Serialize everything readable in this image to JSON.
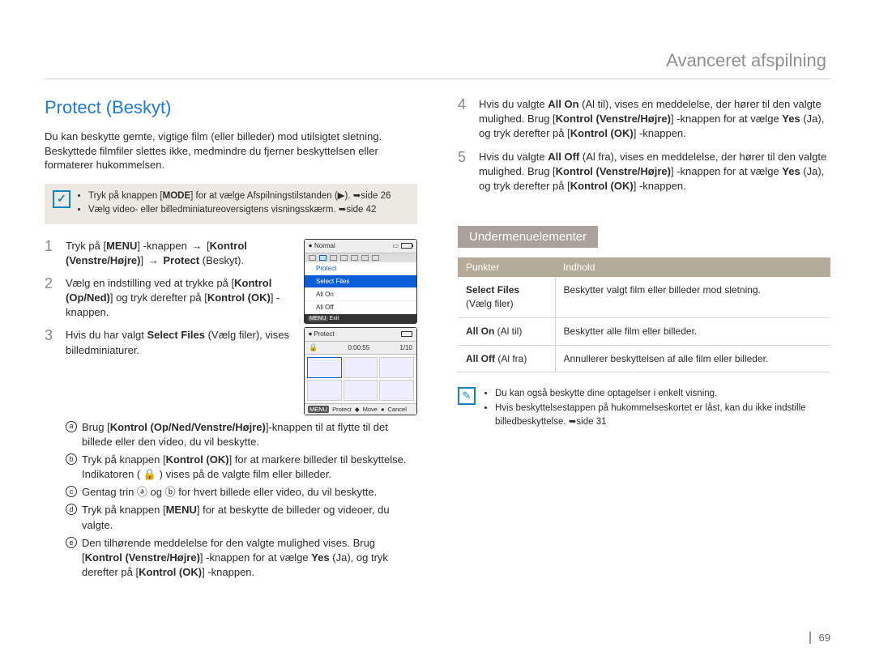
{
  "chapter": "Avanceret afspilning",
  "section_title": "Protect (Beskyt)",
  "intro": "Du kan beskytte gemte, vigtige film (eller billeder) mod utilsigtet sletning. Beskyttede filmfiler slettes ikke, medmindre du fjerner beskyttelsen eller formaterer hukommelsen.",
  "note_a": {
    "items": [
      "Tryk på knappen [<b>MODE</b>] for at vælge Afspilningstilstanden (▶). ➥side 26",
      "Vælg video- eller billedminiatureoversigtens visningsskærm. ➥side 42"
    ]
  },
  "steps_left": [
    {
      "num": "1",
      "text": "Tryk på [<b>MENU</b>] -knappen <span class='arrow'>→</span> [<b>Kontrol (Venstre/Højre)</b>] <span class='arrow'>→</span> <b>Protect</b> (Beskyt)."
    },
    {
      "num": "2",
      "text": "Vælg en indstilling ved at trykke på [<b>Kontrol (Op/Ned)</b>] og tryk derefter på [<b>Kontrol (OK)</b>] -knappen."
    },
    {
      "num": "3",
      "text": "Hvis du har valgt <b>Select Files</b> (Vælg filer), vises billedminiaturer."
    }
  ],
  "substeps": [
    {
      "letter": "a",
      "text": "Brug [<b>Kontrol (Op/Ned/Venstre/Højre)</b>]-knappen til at flytte til det billede eller den video, du vil beskytte."
    },
    {
      "letter": "b",
      "text": "Tryk på knappen [<b>Kontrol (OK)</b>] for at markere billeder til beskyttelse. Indikatoren ( 🔒 ) vises på de valgte film eller billeder."
    },
    {
      "letter": "c",
      "text": "Gentag trin ⓐ og ⓑ for hvert billede eller video, du vil beskytte."
    },
    {
      "letter": "d",
      "text": "Tryk på knappen [<b>MENU</b>] for at beskytte de billeder og videoer, du valgte."
    },
    {
      "letter": "e",
      "text": "Den tilhørende meddelelse for den valgte mulighed vises. Brug [<b>Kontrol (Venstre/Højre)</b>] -knappen for at vælge <b>Yes</b> (Ja), og tryk derefter på [<b>Kontrol (OK)</b>] -knappen."
    }
  ],
  "steps_right": [
    {
      "num": "4",
      "text": "Hvis du valgte <b>All On</b> (Al til), vises en meddelelse, der hører til den valgte mulighed. Brug [<b>Kontrol (Venstre/Højre)</b>] -knappen for at vælge <b>Yes</b> (Ja), og tryk derefter på [<b>Kontrol (OK)</b>] -knappen."
    },
    {
      "num": "5",
      "text": "Hvis du valgte <b>All Off</b> (Al fra), vises en meddelelse, der hører til den valgte mulighed. Brug [<b>Kontrol (Venstre/Højre)</b>] -knappen for at vælge <b>Yes</b> (Ja), og tryk derefter på [<b>Kontrol (OK)</b>] -knappen."
    }
  ],
  "fig1": {
    "status": "Normal",
    "rows": {
      "protect": "Protect",
      "select": "Select Files",
      "allon": "All On",
      "alloff": "All Off"
    },
    "footer": {
      "menu": "MENU",
      "exit": "Exit"
    }
  },
  "fig2": {
    "title": "Protect",
    "time": "0:00:55",
    "count": "1/10",
    "footer": {
      "menu": "MENU",
      "protect": "Protect",
      "pad": "◆",
      "move": "Move",
      "ok": "●",
      "cancel": "Cancel"
    }
  },
  "submenu_header": "Undermenuelementer",
  "submenu": {
    "head_left": "Punkter",
    "head_right": "Indhold",
    "rows": [
      {
        "left": "<b>Select Files</b><br>(Vælg filer)",
        "right": "Beskytter valgt film eller billeder mod sletning."
      },
      {
        "left": "<b>All On</b> (Al til)",
        "right": "Beskytter alle film eller billeder."
      },
      {
        "left": "<b>All Off</b> (Al fra)",
        "right": "Annullerer beskyttelsen af alle film eller billeder."
      }
    ]
  },
  "note_b": {
    "items": [
      "Du kan også beskytte dine optagelser i enkelt visning.",
      "Hvis beskyttelsestappen på hukommelseskortet er låst, kan du ikke indstille billedbeskyttelse. ➥side 31"
    ]
  },
  "page_num": "69"
}
